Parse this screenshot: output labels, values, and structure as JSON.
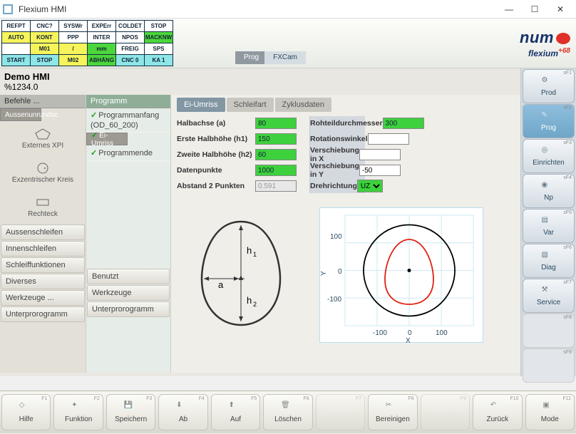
{
  "window": {
    "title": "Flexium HMI"
  },
  "status_grid": [
    [
      "REFPT",
      "CNC?",
      "SYSWr",
      "EXPErr",
      "COLDET",
      "STOP"
    ],
    [
      "AUTO",
      "KONT",
      "PPP",
      "INTER",
      "NPOS",
      "MACKNW"
    ],
    [
      "",
      "M01",
      "/",
      "mm",
      "FREIG",
      "SPS"
    ],
    [
      "START",
      "STOP",
      "M02",
      "ABHÄNG",
      "CNC 0",
      "KA 1"
    ]
  ],
  "status_classes": [
    [
      "w",
      "w",
      "w",
      "w",
      "w",
      "w"
    ],
    [
      "y",
      "y",
      "w",
      "w",
      "w",
      "g"
    ],
    [
      "w",
      "y",
      "y",
      "g",
      "w",
      "w"
    ],
    [
      "c",
      "c",
      "y",
      "g",
      "c",
      "c"
    ]
  ],
  "breadcrumb": {
    "prog": "Prog",
    "fxcam": "FXCam"
  },
  "logo": {
    "brand": "num",
    "product": "flexium",
    "suffix": "+68"
  },
  "demo": {
    "title": "Demo HMI",
    "subtitle": "%1234.0"
  },
  "col_a": {
    "header": "Befehle ...",
    "selected": "Aussenunrundsc",
    "shapes": [
      {
        "label": "Externes XPI"
      },
      {
        "label": "Exzentrischer Kreis"
      },
      {
        "label": "Rechteck"
      }
    ],
    "buttons": [
      "Aussenschleifen",
      "Innenschleifen",
      "Schleiffunktionen",
      "Diverses",
      "Werkzeuge ...",
      "Unterprorogramm"
    ]
  },
  "col_b": {
    "header": "Programm",
    "items": [
      {
        "label": "Programmanfang (OD_60_200)",
        "checked": true,
        "twoLine": true
      },
      {
        "label": "Ei-Umriss",
        "checked": true,
        "selected": true
      },
      {
        "label": "Programmende",
        "checked": true
      }
    ],
    "footer": [
      "Benutzt",
      "Werkzeuge",
      "Unterprorogramm"
    ]
  },
  "tabs": [
    "Ei-Umriss",
    "Schleifart",
    "Zyklusdaten"
  ],
  "params_left": [
    {
      "label": "Halbachse (a)",
      "value": "80",
      "cls": "g"
    },
    {
      "label": "Erste Halbhöhe (h1)",
      "value": "150",
      "cls": "g"
    },
    {
      "label": "Zweite Halbhöhe (h2)",
      "value": "60",
      "cls": "g"
    },
    {
      "label": "Datenpunkte",
      "value": "1000",
      "cls": "g"
    },
    {
      "label": "Abstand 2 Punkten",
      "value": "0.591",
      "cls": "r"
    }
  ],
  "params_right": [
    {
      "label": "Rohteildurchmesser",
      "value": "300",
      "cls": "g"
    },
    {
      "label": "Rotationswinkel",
      "value": "",
      "cls": ""
    },
    {
      "label": "Verschiebung in X",
      "value": "",
      "cls": ""
    },
    {
      "label": "Verschiebung in Y",
      "value": "-50",
      "cls": ""
    },
    {
      "label": "Drehrichtung",
      "value": "UZ",
      "cls": "sel"
    }
  ],
  "egg_labels": {
    "h1": "h₁",
    "h2": "h₂",
    "a": "a"
  },
  "chart_data": {
    "type": "line",
    "title": "",
    "xlabel": "X",
    "ylabel": "Y",
    "xlim": [
      -180,
      180
    ],
    "ylim": [
      -180,
      180
    ],
    "xticks": [
      -100,
      0,
      100
    ],
    "yticks": [
      -100,
      0,
      100
    ],
    "series": [
      {
        "name": "rohteil",
        "color": "#000",
        "shape": "circle",
        "cx": 0,
        "cy": 0,
        "r": 150
      },
      {
        "name": "ei-umriss",
        "color": "#e02010",
        "shape": "egg",
        "a": 80,
        "h1": 150,
        "h2": 60,
        "cx": 0,
        "cy": -50
      }
    ],
    "marker": {
      "x": 0,
      "y": 0
    }
  },
  "right_softkeys": [
    {
      "key": "sF1",
      "label": "Prod"
    },
    {
      "key": "sF2",
      "label": "Prog",
      "active": true
    },
    {
      "key": "sF3",
      "label": "Einrichten"
    },
    {
      "key": "sF4",
      "label": "Np"
    },
    {
      "key": "sF5",
      "label": "Var"
    },
    {
      "key": "sF6",
      "label": "Diag"
    },
    {
      "key": "sF7",
      "label": "Service"
    },
    {
      "key": "sF8",
      "label": "",
      "disabled": true
    },
    {
      "key": "sF9",
      "label": "",
      "disabled": true
    }
  ],
  "fbar": [
    {
      "key": "F1",
      "label": "Hilfe"
    },
    {
      "key": "F2",
      "label": "Funktion"
    },
    {
      "key": "F3",
      "label": "Speichern"
    },
    {
      "key": "F4",
      "label": "Ab"
    },
    {
      "key": "F5",
      "label": "Auf"
    },
    {
      "key": "F6",
      "label": "Löschen"
    },
    {
      "key": "F7",
      "label": "",
      "disabled": true
    },
    {
      "key": "F8",
      "label": "Bereinigen"
    },
    {
      "key": "F9",
      "label": "",
      "disabled": true
    },
    {
      "key": "F10",
      "label": "Zurück"
    },
    {
      "key": "F11",
      "label": "Mode"
    }
  ]
}
